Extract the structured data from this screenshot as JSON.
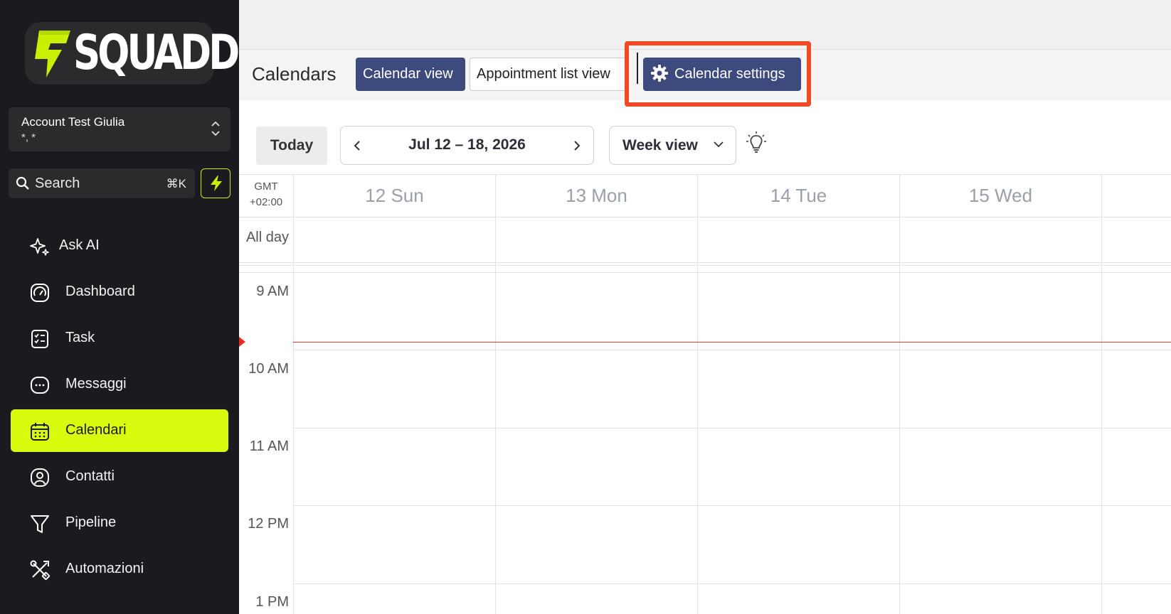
{
  "sidebar": {
    "brand": "SQUADD",
    "account": {
      "name": "Account Test Giulia",
      "sub": "*, *"
    },
    "search": {
      "label": "Search",
      "shortcut": "⌘K"
    },
    "items": [
      {
        "label": "Ask AI",
        "icon": "sparkle-icon"
      },
      {
        "label": "Dashboard",
        "icon": "gauge-icon"
      },
      {
        "label": "Task",
        "icon": "task-list-icon"
      },
      {
        "label": "Messaggi",
        "icon": "chat-icon"
      },
      {
        "label": "Calendari",
        "icon": "calendar-icon",
        "active": true
      },
      {
        "label": "Contatti",
        "icon": "user-circle-icon"
      },
      {
        "label": "Pipeline",
        "icon": "filter-icon"
      },
      {
        "label": "Automazioni",
        "icon": "tools-icon"
      }
    ],
    "accent_color": "#d8fb0e"
  },
  "header": {
    "title": "Calendars",
    "tabs": [
      {
        "label": "Calendar view"
      },
      {
        "label": "Appointment list view"
      },
      {
        "label": "Calendar settings"
      }
    ]
  },
  "controls": {
    "today": "Today",
    "range": "Jul 12 – 18, 2026",
    "view": "Week view"
  },
  "grid": {
    "timezone_line1": "GMT",
    "timezone_line2": "+02:00",
    "allday": "All day",
    "days": [
      "12 Sun",
      "13 Mon",
      "14 Tue",
      "15 Wed"
    ],
    "hours": [
      "9 AM",
      "10 AM",
      "11 AM",
      "12 PM",
      "1 PM"
    ]
  }
}
